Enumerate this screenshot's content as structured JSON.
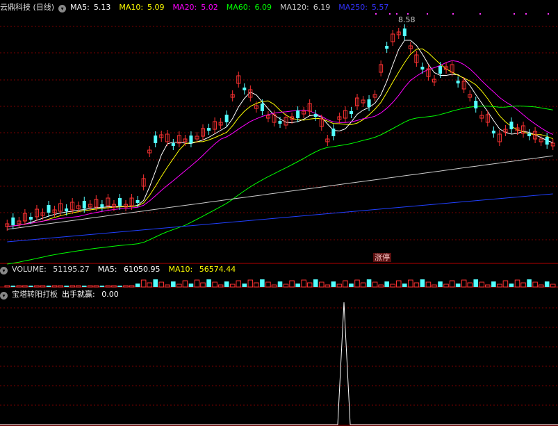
{
  "main_panel": {
    "title": "云鼎科技 (日线)",
    "indicators": [
      {
        "label": "MA5:",
        "value": "5.13",
        "color": "#ffffff"
      },
      {
        "label": "MA10:",
        "value": "5.09",
        "color": "#ffff00"
      },
      {
        "label": "MA20:",
        "value": "5.02",
        "color": "#ff00ff"
      },
      {
        "label": "MA60:",
        "value": "6.09",
        "color": "#00ff00"
      },
      {
        "label": "MA120:",
        "value": "6.19",
        "color": "#cccccc"
      },
      {
        "label": "MA250:",
        "value": "5.57",
        "color": "#0000ff"
      }
    ],
    "high_price_label": "8.58",
    "limit_up_badge": "涨停"
  },
  "volume_panel": {
    "name": "VOLUME:",
    "value": "51195.27",
    "ma5_label": "MA5:",
    "ma5_value": "61050.95",
    "ma10_label": "MA10:",
    "ma10_value": "56574.44"
  },
  "signal_panel": {
    "name": "宝塔转阳打板",
    "signal_label": "出手就赢:",
    "signal_value": "0.00"
  },
  "colors": {
    "up": "#ff3232",
    "down": "#54ffff",
    "grid": "#7a0000",
    "divider": "#b40000",
    "signal": "#ffffff"
  }
}
